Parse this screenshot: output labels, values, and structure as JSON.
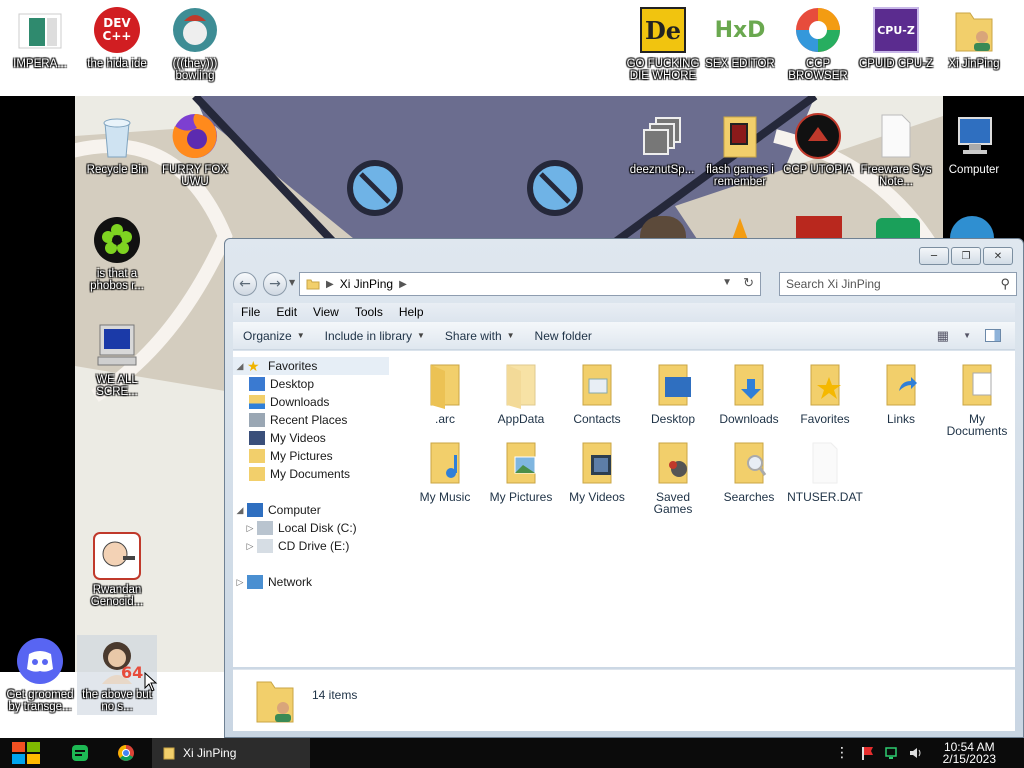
{
  "desktop": {
    "icons": {
      "imperial": "IMPERA...",
      "devcpp": "the hida ide",
      "theyre_bowling": "(((they))) bowling",
      "recycle_bin": "Recycle Bin",
      "furry_fox": "FURRY FOX UWU",
      "phobos": "is that a phobos r...",
      "we_all_scream": "WE ALL SCRE...",
      "rwandan": "Rwandan Genocid...",
      "discord": "Get groomed by transge...",
      "above": "the above but no s...",
      "go_die": "GO FUCKING DIE WHORE",
      "sex_editor": "SEX EDITOR",
      "ccp_browser": "CCP BROWSER",
      "cpuid": "CPUID CPU-Z",
      "xi_desktop": "Xi JinPing",
      "deeznut": "deeznutSp...",
      "flash_games": "flash games i remember",
      "ccp_utopia": "CCP UTOPIA",
      "freeware": "Freeware Sys Note...",
      "computer": "Computer"
    },
    "devcpp_badge": "DEV\nC++",
    "cpuz_badge": "CPU-Z",
    "de_badge": "De",
    "hxd_badge": "HxD",
    "badge_64": "64"
  },
  "window": {
    "address_crumb": "Xi JinPing",
    "search_placeholder": "Search Xi JinPing",
    "menu": [
      "File",
      "Edit",
      "View",
      "Tools",
      "Help"
    ],
    "commands": {
      "organize": "Organize",
      "include": "Include in library",
      "share": "Share with",
      "new_folder": "New folder"
    },
    "nav": {
      "favorites": "Favorites",
      "desktop": "Desktop",
      "downloads": "Downloads",
      "recent": "Recent Places",
      "videos": "My Videos",
      "pictures": "My Pictures",
      "documents": "My Documents",
      "computer": "Computer",
      "local_disk": "Local Disk (C:)",
      "cd_drive": "CD Drive (E:)",
      "network": "Network"
    },
    "files": [
      ".arc",
      "AppData",
      "Contacts",
      "Desktop",
      "Downloads",
      "Favorites",
      "Links",
      "My Documents",
      "My Music",
      "My Pictures",
      "My Videos",
      "Saved Games",
      "Searches",
      "NTUSER.DAT"
    ],
    "item_count": "14 items"
  },
  "taskbar": {
    "task_label": "Xi JinPing",
    "time": "10:54 AM",
    "date": "2/15/2023"
  },
  "colors": {
    "folder": "#f2cf6b",
    "selection": "#e6eef6",
    "taskbar": "#0b0b0b"
  }
}
